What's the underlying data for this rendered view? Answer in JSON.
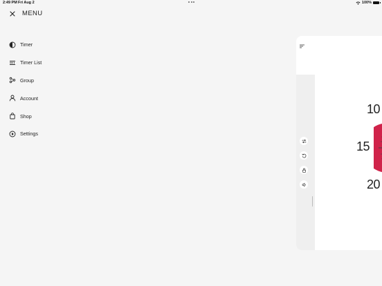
{
  "status_bar": {
    "time": "2:49 PM",
    "date": "Fri Aug 2",
    "battery": "100%"
  },
  "menu": {
    "title": "MENU",
    "items": [
      {
        "label": "Timer",
        "icon": "timer-icon"
      },
      {
        "label": "Timer List",
        "icon": "timer-list-icon"
      },
      {
        "label": "Group",
        "icon": "group-icon"
      },
      {
        "label": "Account",
        "icon": "account-icon"
      },
      {
        "label": "Shop",
        "icon": "shop-icon"
      },
      {
        "label": "Settings",
        "icon": "settings-icon"
      }
    ]
  },
  "preview": {
    "dial_numbers": [
      "10",
      "15",
      "20"
    ],
    "tools": [
      "repeat-icon",
      "reset-icon",
      "lock-icon",
      "sound-icon"
    ]
  },
  "colors": {
    "background": "#f5f5f5",
    "accent": "#d0234a"
  }
}
